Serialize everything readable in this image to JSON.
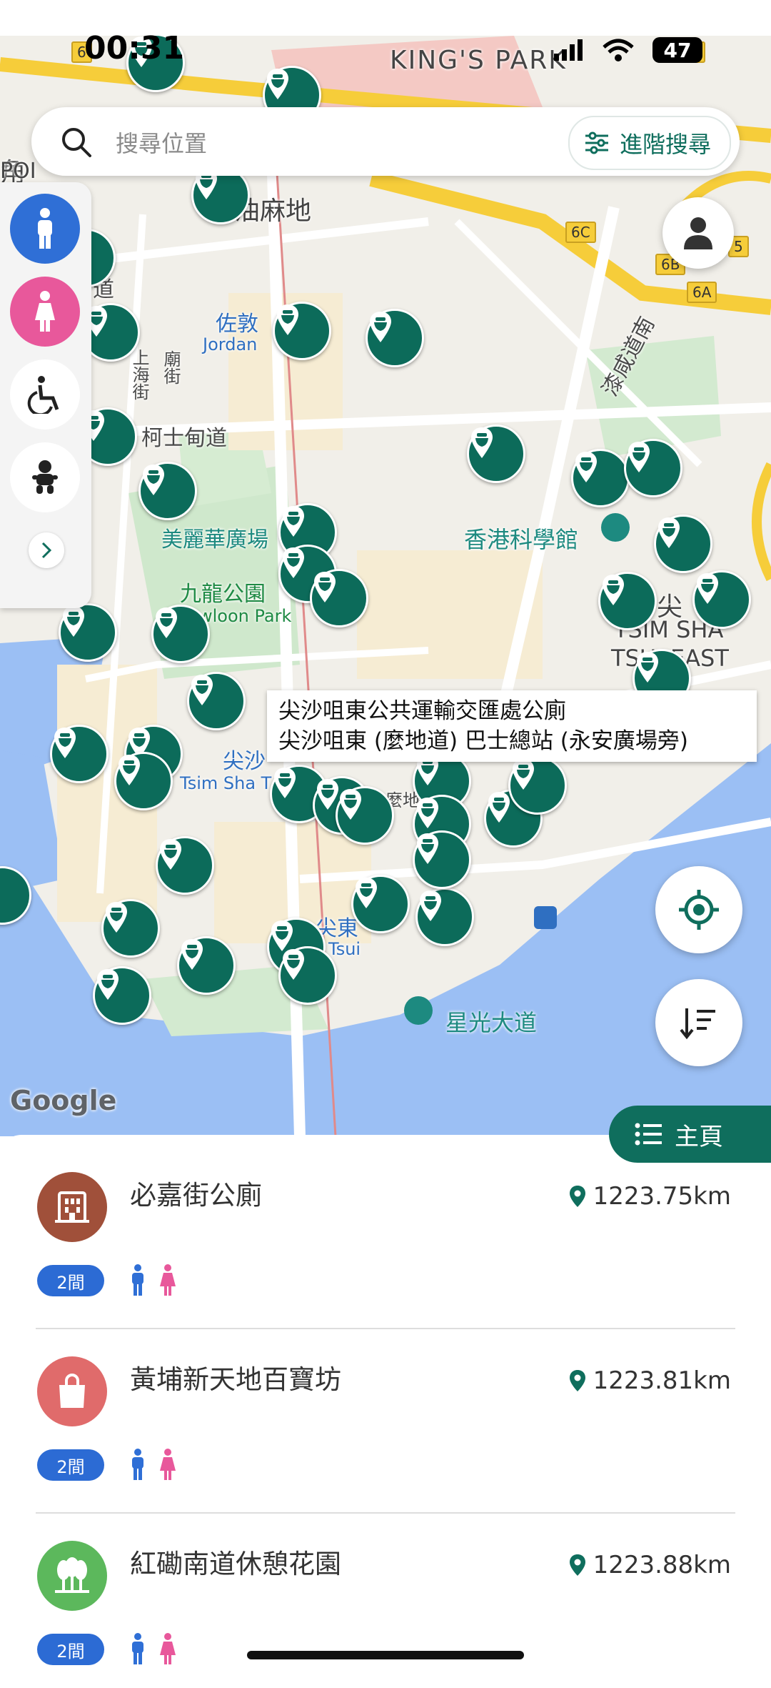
{
  "status_bar": {
    "time": "00:31",
    "battery": "47"
  },
  "search": {
    "placeholder": "搜尋位置",
    "advanced_label": "進階搜尋"
  },
  "map": {
    "labels": {
      "kings_park": "KING'S PARK",
      "yau_ma_tei": "油麻地",
      "jordan_zh": "佐敦",
      "jordan_en": "Jordan",
      "shanghai_st": "上海街",
      "temple_st": "廟街",
      "austin_rd": "柯士甸道",
      "chatham_rd": "漆咸道南",
      "mira_place": "美麗華廣場",
      "kowloon_park_zh": "九龍公園",
      "kowloon_park_en": "wloon Park",
      "tst_zh": "尖沙",
      "tst_en": "Tsim Sha T",
      "tst_east_zh": "尖",
      "tst_east_en1": "TSIM SHA",
      "tst_east_en2": "TSUI EAST",
      "science_museum": "香港科學館",
      "avenue_of_stars": "星光大道",
      "east_tsui_zh": "尖東",
      "east_tsui_en": "Tsui",
      "mody_rd": "麼地道",
      "left_po": "POI",
      "left_corner": "角",
      "left_road": "道",
      "google": "Google"
    },
    "road_badges": [
      "6C",
      "6B",
      "6A",
      "5",
      "6",
      "7A"
    ],
    "tooltip": {
      "line1": "尖沙咀東公共運輸交匯處公廁",
      "line2": "尖沙咀東 (麼地道) 巴士總站 (永安廣場旁)"
    },
    "pin_color": "#0c6b5a"
  },
  "filters": {
    "items": [
      "male-filter",
      "female-filter",
      "accessible-filter",
      "baby-filter"
    ],
    "colors": {
      "male": "#2f6fd6",
      "female": "#e8589b"
    }
  },
  "home_tab": {
    "label": "主頁"
  },
  "list": {
    "items": [
      {
        "name": "必嘉街公廁",
        "distance": "1223.75km",
        "rooms": "2間",
        "icon": "building-icon",
        "color": "#a0503a"
      },
      {
        "name": "黃埔新天地百寶坊",
        "distance": "1223.81km",
        "rooms": "2間",
        "icon": "shopping-bag-icon",
        "color": "#e06b6b"
      },
      {
        "name": "紅磡南道休憩花園",
        "distance": "1223.88km",
        "rooms": "2間",
        "icon": "park-trees-icon",
        "color": "#5cb85c"
      }
    ],
    "accent": "#0f6e5d"
  }
}
